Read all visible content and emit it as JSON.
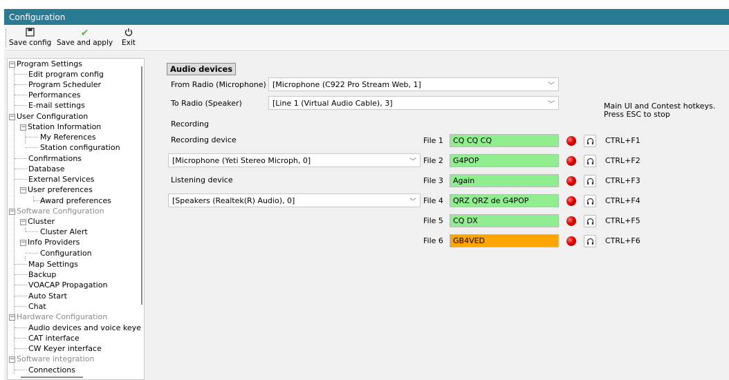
{
  "window": {
    "title": "Configuration"
  },
  "toolbar": {
    "buttons": [
      {
        "label": "Save config",
        "icon": "floppy-disk-icon"
      },
      {
        "label": "Save and apply",
        "icon": "checkmark-icon"
      },
      {
        "label": "Exit",
        "icon": "power-icon"
      }
    ]
  },
  "tree": {
    "items": [
      {
        "label": "Program Settings",
        "expander": "⊟",
        "state": "category"
      },
      {
        "label": "Edit program config"
      },
      {
        "label": "Program Scheduler"
      },
      {
        "label": "Performances"
      },
      {
        "label": "E-mail settings"
      },
      {
        "label": "User Configuration",
        "expander": "⊟",
        "state": "category"
      },
      {
        "label": "Station Information",
        "expander": "⊟"
      },
      {
        "label": "My References"
      },
      {
        "label": "Station configuration"
      },
      {
        "label": "Confirmations"
      },
      {
        "label": "Database"
      },
      {
        "label": "External Services"
      },
      {
        "label": "User preferences",
        "expander": "⊟"
      },
      {
        "label": "Award preferences"
      },
      {
        "label": "Software Configuration",
        "expander": "⊟",
        "state": "disabled"
      },
      {
        "label": "Cluster",
        "expander": "⊟"
      },
      {
        "label": "Cluster Alert"
      },
      {
        "label": "Info Providers",
        "expander": "⊟"
      },
      {
        "label": "Configuration"
      },
      {
        "label": "Map Settings"
      },
      {
        "label": "Backup"
      },
      {
        "label": "VOACAP Propagation"
      },
      {
        "label": "Auto Start"
      },
      {
        "label": "Chat"
      },
      {
        "label": "Hardware Configuration",
        "expander": "⊟",
        "state": "disabled"
      },
      {
        "label": "Audio devices and voice keye",
        "state": "selected"
      },
      {
        "label": "CAT interface"
      },
      {
        "label": "CW Keyer interface"
      },
      {
        "label": "Software integration",
        "expander": "⊟",
        "state": "disabled"
      },
      {
        "label": "Connections"
      }
    ]
  },
  "audio": {
    "section_title": "Audio devices",
    "from_radio_label": "From Radio (Microphone)",
    "from_radio_value": "[Microphone (C922 Pro Stream Web, 1]",
    "to_radio_label": "To Radio (Speaker)",
    "to_radio_value": "[Line 1 (Virtual Audio Cable), 3]",
    "recording_label": "Recording",
    "recording_device_label": "Recording device",
    "recording_device_value": "[Microphone (Yeti Stereo Microph, 0]",
    "listening_device_label": "Listening device",
    "listening_device_value": "[Speakers (Realtek(R) Audio), 0]",
    "hotkeys_note_line1": "Main UI and Contest hotkeys.",
    "hotkeys_note_line2": "Press ESC to stop"
  },
  "files": [
    {
      "label": "File 1",
      "text": "CQ CQ CQ",
      "hotkey": "CTRL+F1",
      "color": "#90ee90"
    },
    {
      "label": "File 2",
      "text": "G4POP",
      "hotkey": "CTRL+F2",
      "color": "#90ee90"
    },
    {
      "label": "File 3",
      "text": "Again",
      "hotkey": "CTRL+F3",
      "color": "#90ee90"
    },
    {
      "label": "File 4",
      "text": "QRZ QRZ de G4POP",
      "hotkey": "CTRL+F4",
      "color": "#90ee90"
    },
    {
      "label": "File 5",
      "text": "CQ DX",
      "hotkey": "CTRL+F5",
      "color": "#90ee90"
    },
    {
      "label": "File 6",
      "text": "GB4VED",
      "hotkey": "CTRL+F6",
      "color": "#ffa500"
    }
  ],
  "icons": {
    "record": "record-icon",
    "listen": "headphones-icon"
  }
}
